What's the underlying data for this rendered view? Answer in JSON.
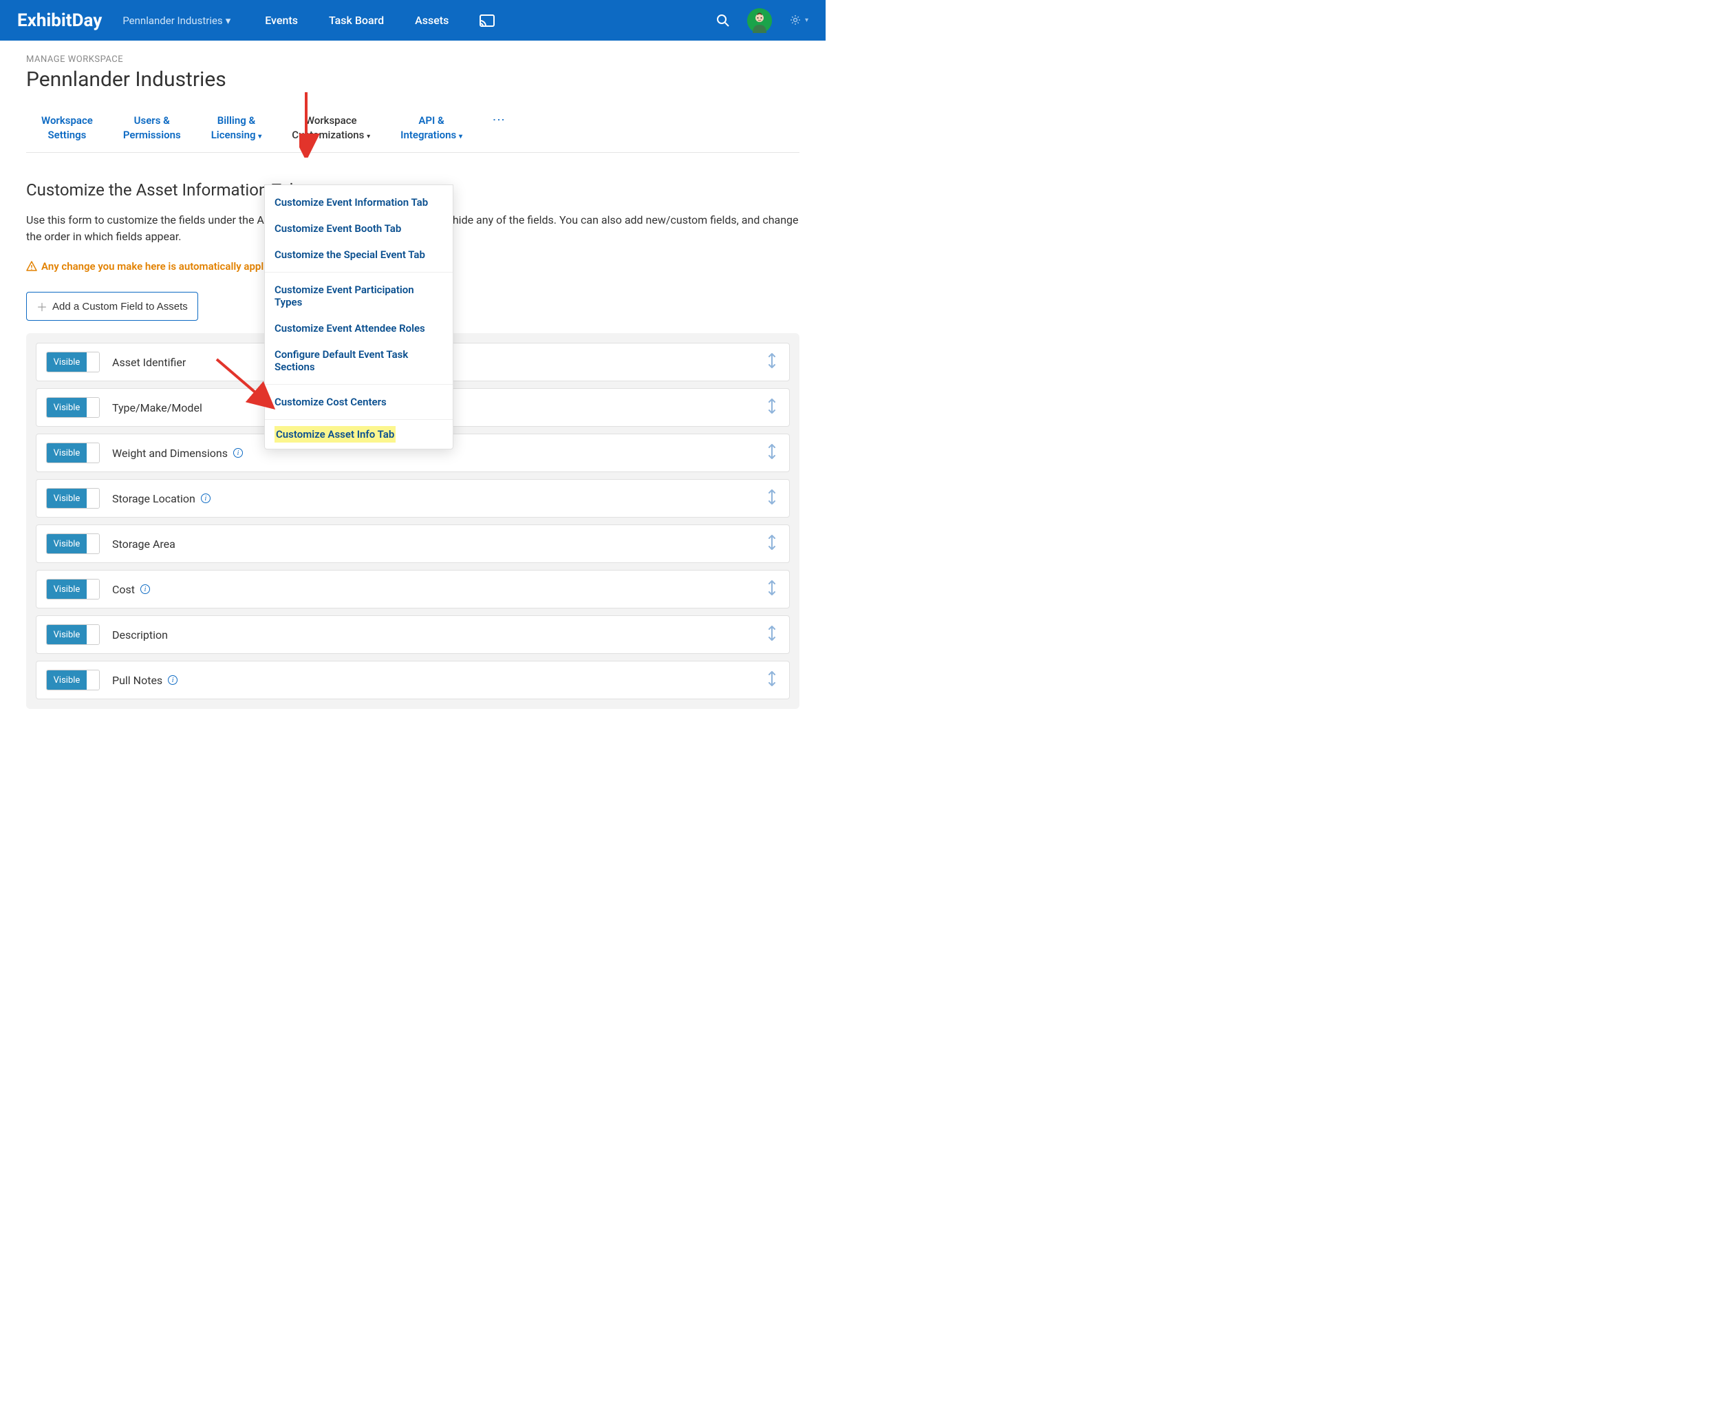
{
  "header": {
    "logo": "ExhibitDay",
    "workspace_selector": "Pennlander Industries",
    "nav": {
      "events": "Events",
      "task_board": "Task Board",
      "assets": "Assets"
    }
  },
  "page": {
    "breadcrumb": "MANAGE WORKSPACE",
    "title": "Pennlander Industries"
  },
  "tabs": {
    "workspace_settings": {
      "line1": "Workspace",
      "line2": "Settings"
    },
    "users_permissions": {
      "line1": "Users &",
      "line2": "Permissions"
    },
    "billing_licensing": {
      "line1": "Billing &",
      "line2": "Licensing"
    },
    "workspace_customizations": {
      "line1": "Workspace",
      "line2": "Customizations"
    },
    "api_integrations": {
      "line1": "API &",
      "line2": "Integrations"
    }
  },
  "dropdown": {
    "section1": [
      "Customize Event Information Tab",
      "Customize Event Booth Tab",
      "Customize the Special Event Tab"
    ],
    "section2": [
      "Customize Event Participation Types",
      "Customize Event Attendee Roles",
      "Configure Default Event Task Sections"
    ],
    "section3": [
      "Customize Cost Centers"
    ],
    "highlighted": "Customize Asset Info Tab"
  },
  "content": {
    "section_title": "Customize the Asset Information Tab",
    "description": "Use this form to customize the fields under the Asset Information tab. You can show or hide any of the fields. You can also add new/custom fields, and change the order in which fields appear.",
    "warning": "Any change you make here is automatically applied to all of your Assets.",
    "add_button": "Add a Custom Field to Assets",
    "toggle_label": "Visible"
  },
  "fields": [
    {
      "label": "Asset Identifier",
      "info": false
    },
    {
      "label": "Type/Make/Model",
      "info": false
    },
    {
      "label": "Weight and Dimensions",
      "info": true
    },
    {
      "label": "Storage Location",
      "info": true
    },
    {
      "label": "Storage Area",
      "info": false
    },
    {
      "label": "Cost",
      "info": true
    },
    {
      "label": "Description",
      "info": false
    },
    {
      "label": "Pull Notes",
      "info": true
    }
  ]
}
